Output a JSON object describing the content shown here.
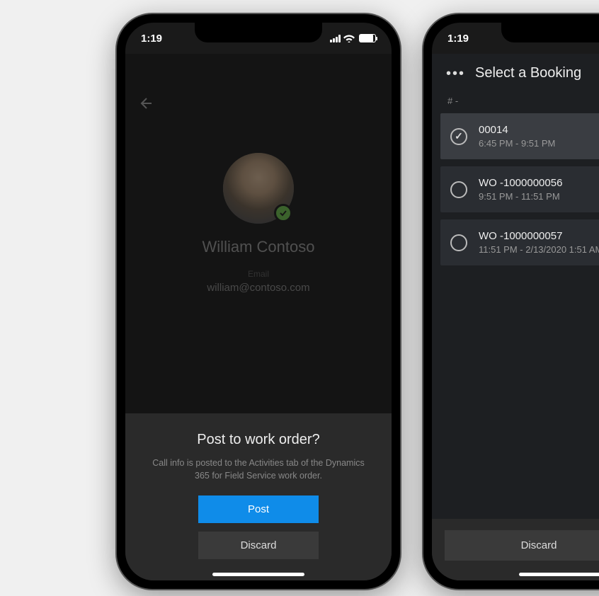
{
  "status": {
    "time": "1:19"
  },
  "left": {
    "contact": {
      "name": "William Contoso",
      "email_label": "Email",
      "email": "william@contoso.com"
    },
    "sheet": {
      "title": "Post to work order?",
      "subtitle": "Call info is posted to the Activities tab of the Dynamics 365 for Field Service work order.",
      "post_label": "Post",
      "discard_label": "Discard"
    }
  },
  "right": {
    "header": "Select a Booking",
    "section_label": "# -",
    "bookings": [
      {
        "title": "00014",
        "time": "6:45 PM - 9:51 PM",
        "selected": true
      },
      {
        "title": "WO -1000000056",
        "time": "9:51 PM - 11:51 PM",
        "selected": false
      },
      {
        "title": "WO -1000000057",
        "time": "11:51 PM - 2/13/2020 1:51 AM",
        "selected": false
      }
    ],
    "discard_label": "Discard"
  }
}
